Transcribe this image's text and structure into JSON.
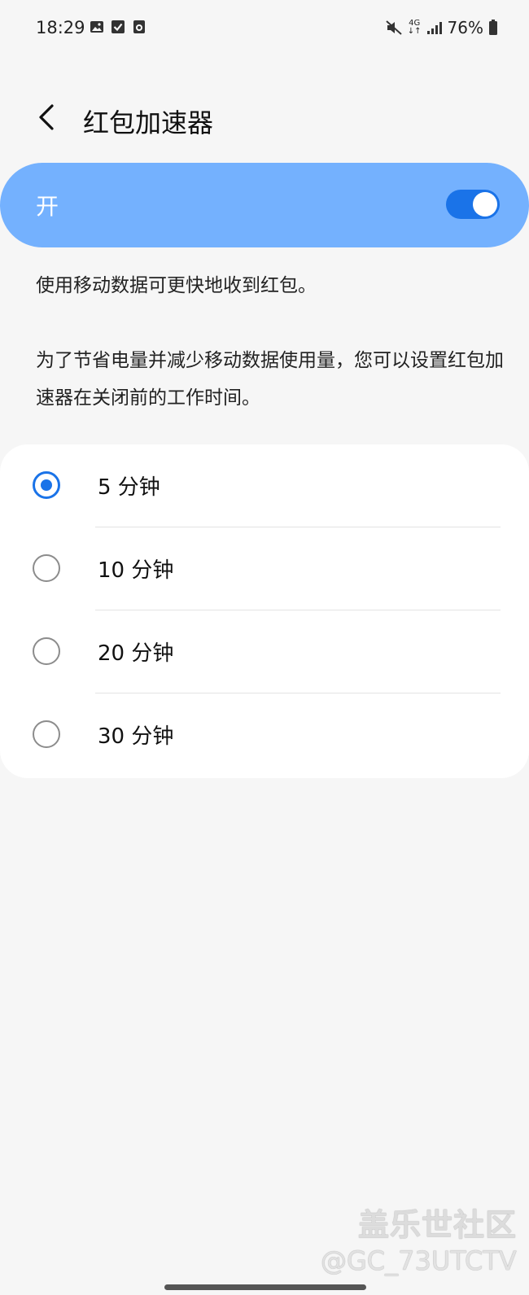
{
  "status_bar": {
    "time": "18:29",
    "left_icons": [
      "image-icon",
      "check-square-icon",
      "app-notification-icon"
    ],
    "network": "4G",
    "battery": "76%"
  },
  "header": {
    "title": "红包加速器"
  },
  "master_switch": {
    "label": "开",
    "state": true
  },
  "descriptions": [
    "使用移动数据可更快地收到红包。",
    "为了节省电量并减少移动数据使用量，您可以设置红包加速器在关闭前的工作时间。"
  ],
  "options": [
    {
      "label": "5 分钟",
      "selected": true
    },
    {
      "label": "10 分钟",
      "selected": false
    },
    {
      "label": "20 分钟",
      "selected": false
    },
    {
      "label": "30 分钟",
      "selected": false
    }
  ],
  "watermark": {
    "line1": "盖乐世社区",
    "line2": "@GC_73UTCTV"
  },
  "colors": {
    "accent": "#1a73e8",
    "master_bg": "#74b1fe",
    "page_bg": "#f6f6f6"
  }
}
